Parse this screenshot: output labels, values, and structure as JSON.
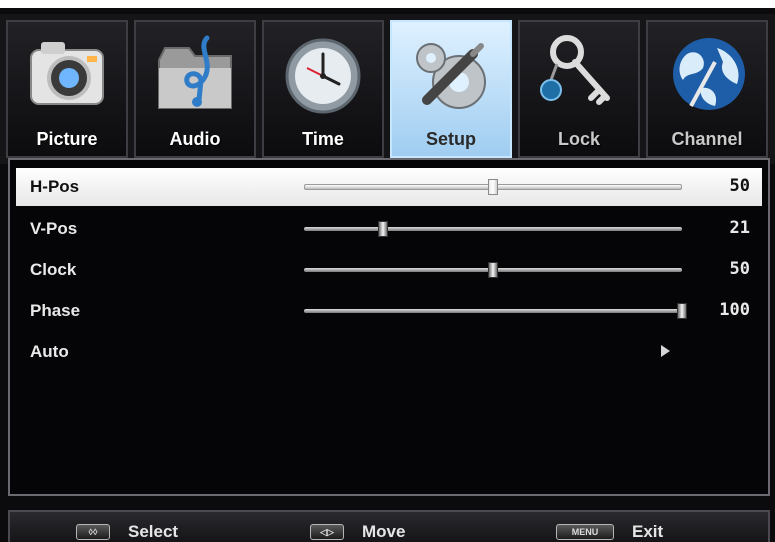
{
  "tabs": [
    {
      "label": "Picture",
      "icon": "camera-icon"
    },
    {
      "label": "Audio",
      "icon": "music-folder-icon"
    },
    {
      "label": "Time",
      "icon": "clock-icon"
    },
    {
      "label": "Setup",
      "icon": "gears-icon",
      "active": true
    },
    {
      "label": "Lock",
      "icon": "key-icon"
    },
    {
      "label": "Channel",
      "icon": "globe-icon"
    }
  ],
  "menu": {
    "items": [
      {
        "label": "H-Pos",
        "value": "50",
        "level": 0.5
      },
      {
        "label": "V-Pos",
        "value": "21",
        "level": 0.21
      },
      {
        "label": "Clock",
        "value": "50",
        "level": 0.5
      },
      {
        "label": "Phase",
        "value": "100",
        "level": 1.0
      },
      {
        "label": "Auto"
      }
    ]
  },
  "footer": {
    "select_key": "◊◊",
    "select_label": "Select",
    "move_key": "◁▷",
    "move_label": "Move",
    "menu_key": "MENU",
    "exit_label": "Exit"
  },
  "colors": {
    "active_tab": "#a9d6f7",
    "background": "#0b0b0d",
    "selected_row": "#f2f2f2"
  }
}
